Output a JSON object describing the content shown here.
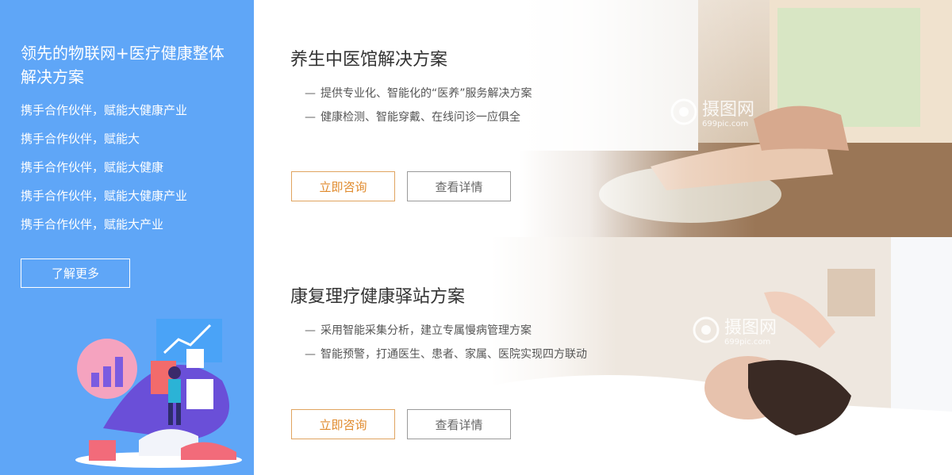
{
  "left": {
    "title": "领先的物联网+医疗健康整体解决方案",
    "items": [
      "携手合作伙伴，赋能大健康产业",
      "携手合作伙伴，赋能大",
      "携手合作伙伴，赋能大健康",
      "携手合作伙伴，赋能大健康产业",
      "携手合作伙伴，赋能大产业"
    ],
    "learn_more": "了解更多"
  },
  "sections": [
    {
      "title": "养生中医馆解决方案",
      "bullets": [
        "提供专业化、智能化的“医养”服务解决方案",
        "健康检测、智能穿戴、在线问诊一应俱全"
      ],
      "consult": "立即咨询",
      "detail": "查看详情"
    },
    {
      "title": "康复理疗健康驿站方案",
      "bullets": [
        "采用智能采集分析，建立专属慢病管理方案",
        "智能预警，打通医生、患者、家属、医院实现四方联动"
      ],
      "consult": "立即咨询",
      "detail": "查看详情"
    }
  ],
  "watermark": {
    "text": "摄图网",
    "sub": "699pic.com"
  },
  "dash": "—",
  "colors": {
    "panel_blue": "#5fa6f7",
    "consult_orange": "#e08a2c",
    "detail_gray": "#666666"
  }
}
